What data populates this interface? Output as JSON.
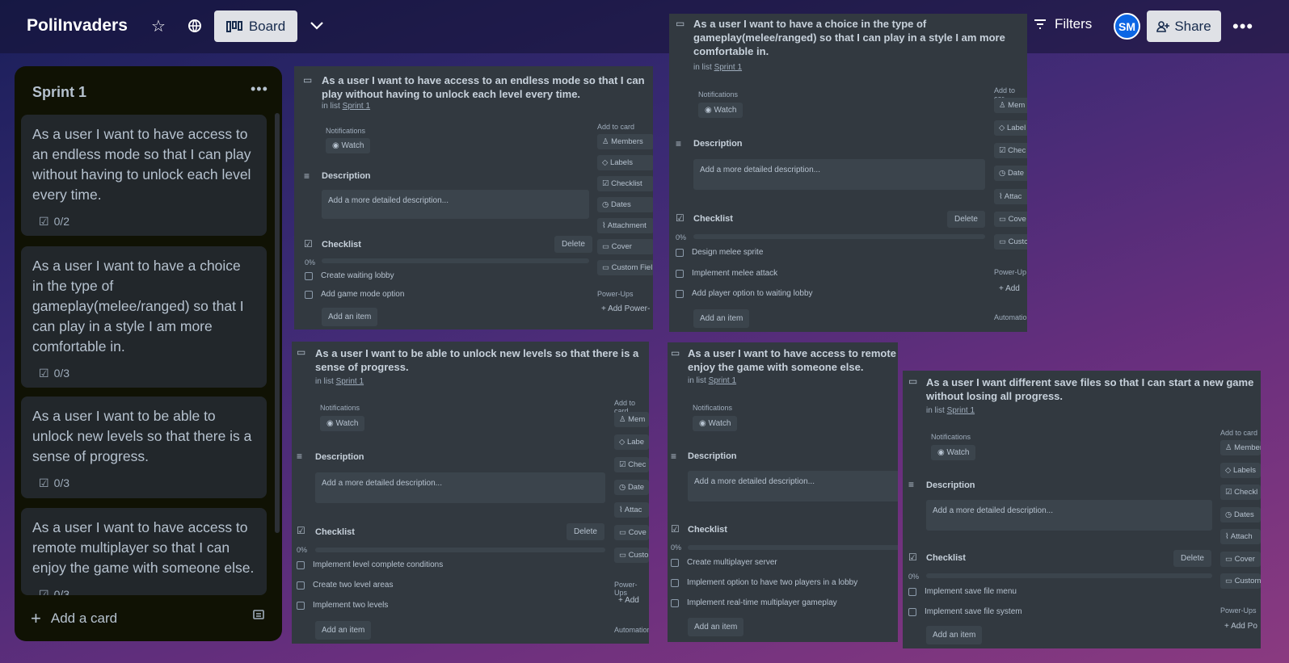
{
  "header": {
    "board_name": "PoliInvaders",
    "view_label": "Board",
    "filters_label": "Filters",
    "avatar_initials": "SM",
    "share_label": "Share"
  },
  "list": {
    "title": "Sprint 1",
    "add_card_label": "Add a card",
    "cards": [
      {
        "text": "As a user I want to have access to an endless mode so that I can play without having to unlock each level every time.",
        "checklist": "0/2"
      },
      {
        "text": "As a user I want to have a choice in the type of gameplay(melee/ranged) so that I can play in a style I am more comfortable in.",
        "checklist": "0/3"
      },
      {
        "text": "As a user I want to be able to unlock new levels so that there is a sense of progress.",
        "checklist": "0/3"
      },
      {
        "text": "As a user I want to have access to remote multiplayer so that I can enjoy the game with someone else.",
        "checklist": "0/3"
      }
    ]
  },
  "common": {
    "in_list_prefix": "in list",
    "list_link": "Sprint 1",
    "notifications": "Notifications",
    "watch": "Watch",
    "description": "Description",
    "desc_placeholder": "Add a more detailed description...",
    "checklist": "Checklist",
    "delete": "Delete",
    "progress": "0%",
    "add_item": "Add an item",
    "add_to_card": "Add to card",
    "power_ups": "Power-Ups",
    "automation": "Automation"
  },
  "panels": {
    "p1": {
      "title": "As a user I want to have access to an endless mode so that I can play without having to unlock each level every time.",
      "items": [
        "Create waiting lobby",
        "Add game mode option"
      ],
      "side": [
        "Members",
        "Labels",
        "Checklist",
        "Dates",
        "Attachment",
        "Cover",
        "Custom Fiel"
      ],
      "power_up_add": "Add Power-"
    },
    "p2": {
      "title": "As a user I want to have a choice in the type of gameplay(melee/ranged) so that I can play in a style I am more comfortable in.",
      "items": [
        "Design melee sprite",
        "Implement melee attack",
        "Add player option to waiting lobby"
      ],
      "side_header": "Add to car",
      "side": [
        "Mem",
        "Label",
        "Chec",
        "Date",
        "Attac",
        "Cove",
        "Custo"
      ],
      "power_up_label": "Power-Up",
      "power_up_add": "Add",
      "automation_label": "Automatio"
    },
    "p3": {
      "title": "As a user I want to be able to unlock new levels so that there is a sense of progress.",
      "items": [
        "Implement level complete conditions",
        "Create two level areas",
        "Implement two levels"
      ],
      "side_header": "Add to card",
      "side": [
        "Mem",
        "Labe",
        "Chec",
        "Date",
        "Attac",
        "Cove",
        "Custo"
      ],
      "power_up_label": "Power-Ups",
      "power_up_add": "Add",
      "automation_label": "Automation"
    },
    "p4": {
      "title": "As a user I want to have access to remote multiplayer so that I can enjoy the game with someone else.",
      "items": [
        "Create multiplayer server",
        "Implement option to have two players in a lobby",
        "Implement real-time multiplayer gameplay"
      ]
    },
    "p5": {
      "title": "As a user I want different save files so that I can start a new game without losing all progress.",
      "items": [
        "Implement save file menu",
        "Implement save file system"
      ],
      "side": [
        "Members",
        "Labels",
        "Checkl",
        "Dates",
        "Attach",
        "Cover",
        "Custom"
      ],
      "power_up_add": "Add Po"
    }
  }
}
